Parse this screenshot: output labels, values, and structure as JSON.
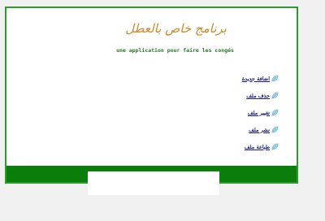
{
  "header": {
    "title": "برنامج خاص بالعطل",
    "subtitle": "une application pour faire les congés"
  },
  "menu": {
    "items": [
      {
        "label": "اضافة جديدة",
        "icon": "leaf-icon"
      },
      {
        "label": "حذف ملف",
        "icon": "leaf-icon"
      },
      {
        "label": "تغيير ملف",
        "icon": "leaf-icon"
      },
      {
        "label": "نشر ملف",
        "icon": "leaf-icon"
      },
      {
        "label": "طباعة ملف",
        "icon": "leaf-icon"
      }
    ]
  },
  "colors": {
    "frame_border": "#2e9a2e",
    "title": "#cc8a2c",
    "subtitle": "#1f7a1f",
    "link": "#1a1a8c",
    "footer_bar": "#0a7d0a",
    "background": "#f1f1f1"
  }
}
